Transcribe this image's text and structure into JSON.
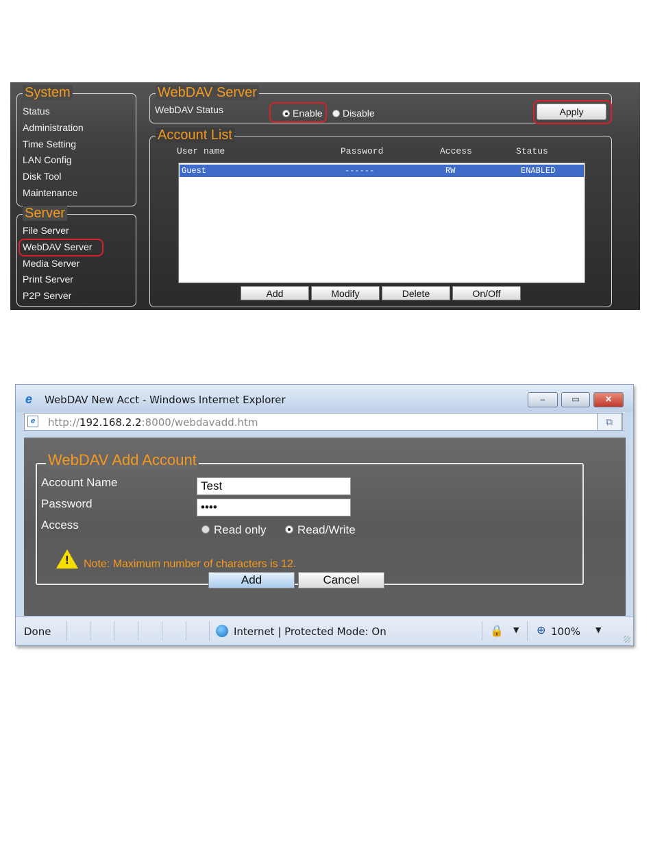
{
  "admin_panel": {
    "system_section": {
      "legend": "System",
      "items": [
        "Status",
        "Administration",
        "Time Setting",
        "LAN Config",
        "Disk Tool",
        "Maintenance"
      ]
    },
    "server_section": {
      "legend": "Server",
      "items": [
        "File Server",
        "WebDAV Server",
        "Media Server",
        "Print Server",
        "P2P Server"
      ],
      "highlighted_item": "WebDAV Server"
    },
    "webdav_server": {
      "legend": "WebDAV Server",
      "status_label": "WebDAV Status",
      "options": [
        {
          "label": "Enable",
          "selected": true
        },
        {
          "label": "Disable",
          "selected": false
        }
      ],
      "apply_label": "Apply"
    },
    "account_list": {
      "legend": "Account List",
      "columns": [
        "User name",
        "Password",
        "Access",
        "Status"
      ],
      "rows": [
        {
          "user": "Guest",
          "password": "------",
          "access": "RW",
          "status": "ENABLED",
          "selected": true
        }
      ],
      "buttons": [
        "Add",
        "Modify",
        "Delete",
        "On/Off"
      ]
    },
    "highlight_color": "#d8202a",
    "legend_color": "#f59a1e"
  },
  "ie_window": {
    "title": "WebDAV New Acct - Windows Internet Explorer",
    "address": {
      "prefix": "http://",
      "host": "192.168.2.2",
      "rest": ":8000/webdavadd.htm"
    },
    "window_buttons": {
      "minimize": "–",
      "maximize": "▭",
      "close": "✕"
    },
    "form": {
      "legend": "WebDAV Add Account",
      "account_name_label": "Account Name",
      "account_name_value": "Test",
      "password_label": "Password",
      "password_value": "••••",
      "access_label": "Access",
      "access_options": [
        {
          "label": "Read only",
          "selected": false
        },
        {
          "label": "Read/Write",
          "selected": true
        }
      ],
      "note": "Note: Maximum number of characters is 12.",
      "add_label": "Add",
      "cancel_label": "Cancel"
    },
    "status_bar": {
      "status": "Done",
      "zone": "Internet | Protected Mode: On",
      "zoom": "100%"
    }
  }
}
